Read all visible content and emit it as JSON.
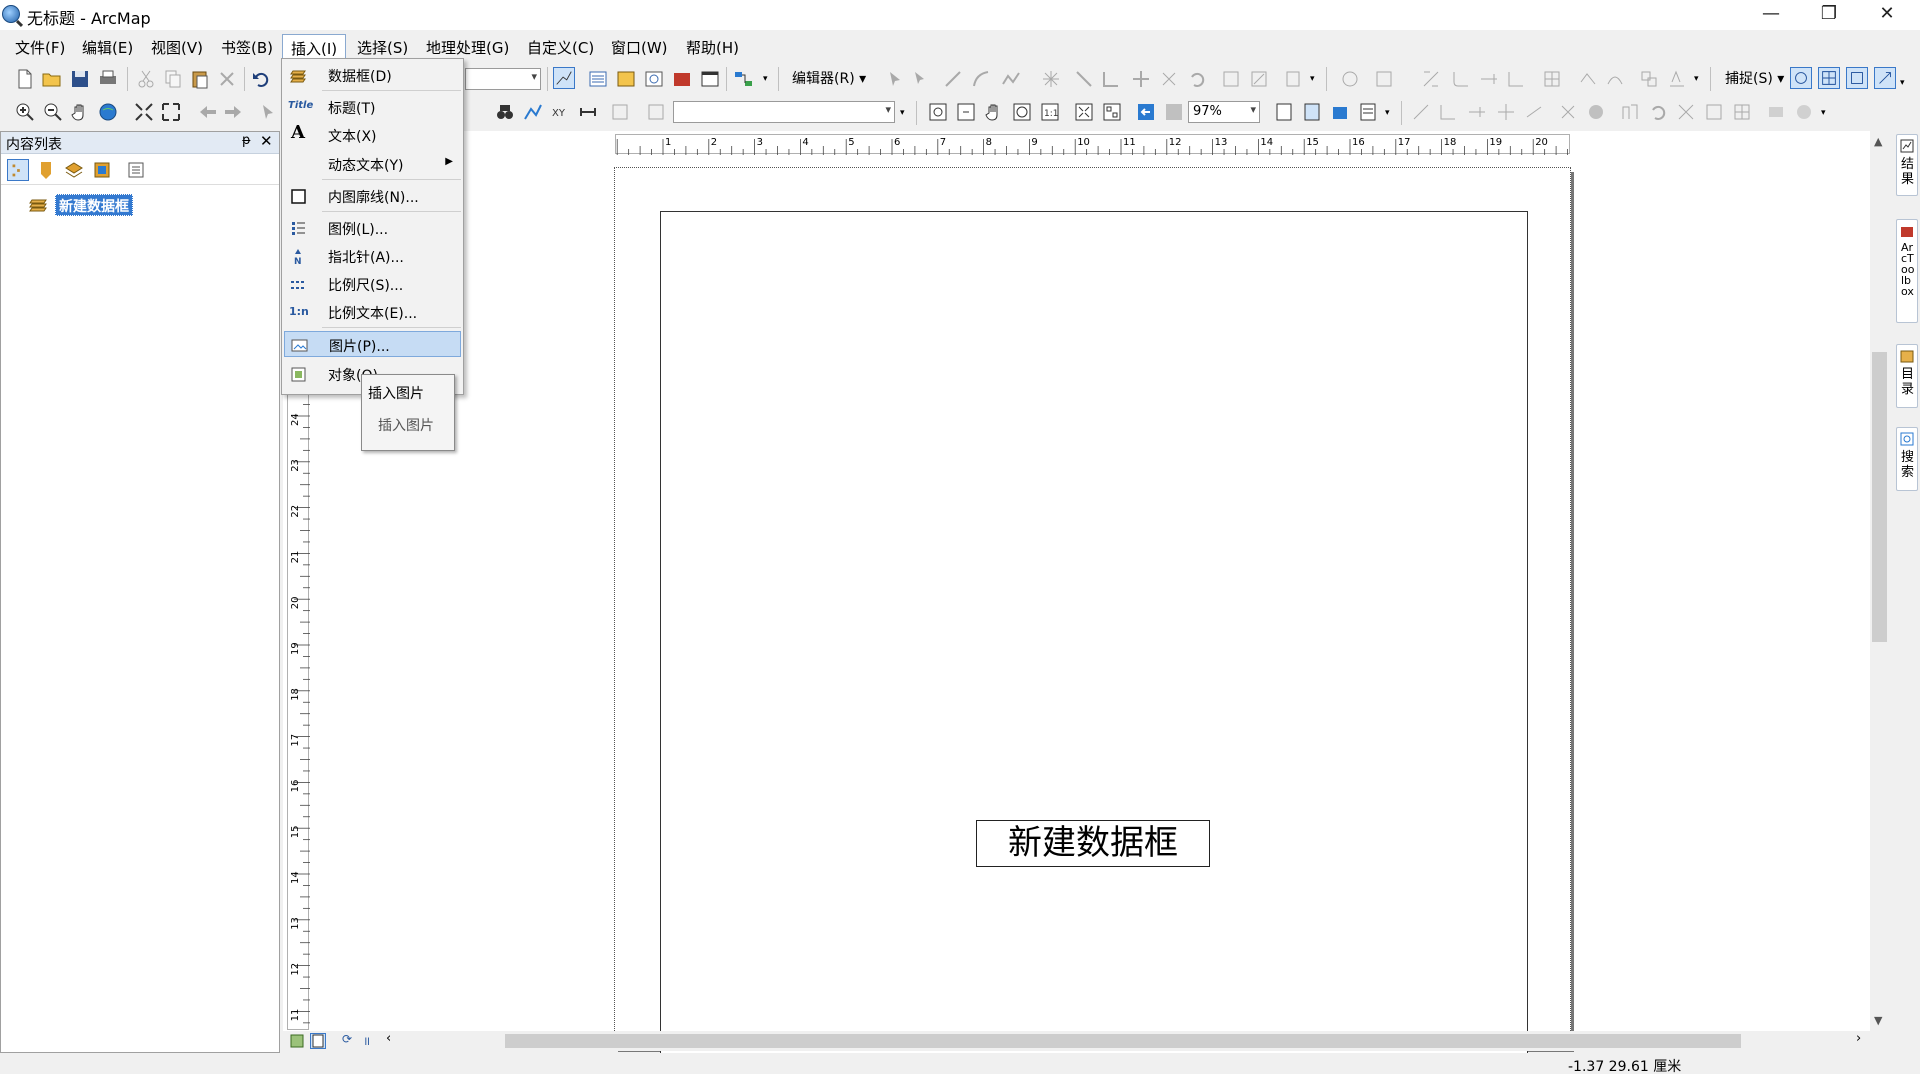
{
  "window": {
    "title": "无标题 - ArcMap",
    "minimize": "—",
    "restore": "❐",
    "close": "✕"
  },
  "menubar": {
    "items": [
      "文件(F)",
      "编辑(E)",
      "视图(V)",
      "书签(B)",
      "插入(I)",
      "选择(S)",
      "地理处理(G)",
      "自定义(C)",
      "窗口(W)",
      "帮助(H)"
    ]
  },
  "toolbar": {
    "editor_label": "编辑器(R)",
    "snapping_label": "捕捉(S)",
    "zoom_value": "97%"
  },
  "toc": {
    "title": "内容列表",
    "pin": "ᵽ",
    "close": "✕",
    "layer": "新建数据框"
  },
  "insert_menu": {
    "items": [
      {
        "label": "数据框(D)",
        "icon": "data-frame-icon"
      },
      {
        "label": "标题(T)",
        "icon": "title-icon"
      },
      {
        "label": "文本(X)",
        "icon": "text-icon"
      },
      {
        "label": "动态文本(Y)",
        "icon": "dynamic-text-icon"
      },
      {
        "label": "内图廓线(N)...",
        "icon": "neatline-icon"
      },
      {
        "label": "图例(L)...",
        "icon": "legend-icon"
      },
      {
        "label": "指北针(A)...",
        "icon": "north-arrow-icon"
      },
      {
        "label": "比例尺(S)...",
        "icon": "scale-bar-icon"
      },
      {
        "label": "比例文本(E)...",
        "icon": "scale-text-icon"
      },
      {
        "label": "图片(P)...",
        "icon": "picture-icon"
      },
      {
        "label": "对象(O)...",
        "icon": "object-icon"
      }
    ],
    "title_icon_text": "Title",
    "text_icon_text": "A",
    "scale_text_icon_text": "1:n",
    "highlighted": "图片(P)..."
  },
  "tooltip": {
    "title": "插入图片",
    "description": "插入图片"
  },
  "layout": {
    "dataframe_label": "新建数据框",
    "hruler_ticks": [
      "1",
      "2",
      "3",
      "4",
      "5",
      "6",
      "7",
      "8",
      "9",
      "10",
      "11",
      "12",
      "13",
      "14",
      "15",
      "16",
      "17",
      "18",
      "19",
      "20"
    ],
    "vruler_ticks": [
      "24",
      "23",
      "22",
      "21",
      "20",
      "19",
      "18",
      "17",
      "16",
      "15",
      "14",
      "13",
      "12",
      "11"
    ]
  },
  "side_tabs": [
    {
      "label": "结果",
      "icon": "results-icon"
    },
    {
      "label": "ArcToolbox",
      "icon": "arctoolbox-icon"
    },
    {
      "label": "目录",
      "icon": "catalog-icon"
    },
    {
      "label": "搜索",
      "icon": "search-icon"
    }
  ],
  "statusbar": {
    "coordinates": "-1.37  29.61 厘米"
  }
}
